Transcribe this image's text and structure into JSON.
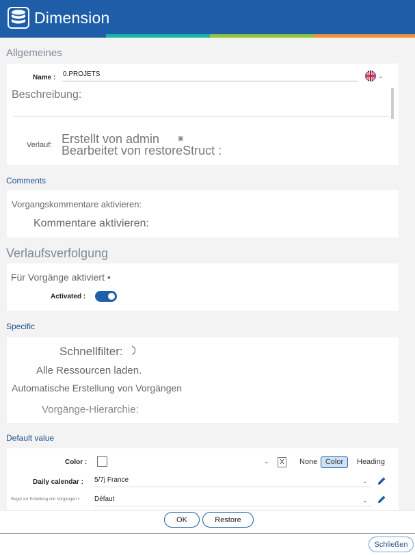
{
  "window": {
    "title": "Dimension",
    "logo_icon": "database-icon"
  },
  "colors": {
    "brand": "#1e5ea8",
    "accent_teal": "#1ab3a6",
    "accent_green": "#8fc43f",
    "accent_orange": "#f0913a",
    "toggle_on": "#1f5ea9"
  },
  "general": {
    "title": "Allgemeines",
    "name_label": "Name :",
    "name_value": "0.PROJETS",
    "language_icon": "uk-flag-icon",
    "description_label": "Beschreibung:",
    "history_label": "Verlauf:",
    "created_by": "Erstellt von admin",
    "edited_by": "Bearbeitet von restoreStruct :"
  },
  "comments": {
    "title": "Comments",
    "task_comments": "Vorgangskommentare aktivieren:",
    "enable_comments": "Kommentare aktivieren:"
  },
  "tracking": {
    "title": "Verlaufsverfolgung",
    "enabled_for_tasks": "Für Vorgänge aktiviert •",
    "activated_label": "Activated :",
    "activated": true
  },
  "specific": {
    "title": "Specific",
    "quick_filter": "Schnellfilter:",
    "load_all_resources": "Alle Ressourcen laden.",
    "auto_create_tasks": "Automatische Erstellung von Vorgängen",
    "task_hierarchy": "Vorgänge-Hierarchie:"
  },
  "default_value": {
    "title": "Default value",
    "color_label": "Color :",
    "clear_label": "X",
    "options": {
      "none": "None",
      "color": "Color",
      "heading": "Heading"
    },
    "selected_option": "Color",
    "calendar_label": "Daily calendar :",
    "calendar_value": "5/7j France",
    "rule_label": "Regel zur Erstellung von Vorgängen •",
    "rule_value": "Défaut"
  },
  "buttons": {
    "ok": "OK",
    "restore": "Restore",
    "close": "Schließen"
  }
}
